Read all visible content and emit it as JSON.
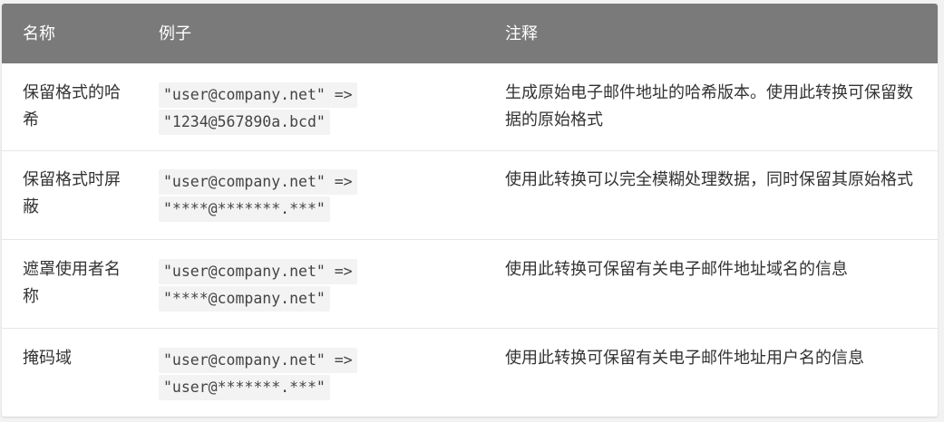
{
  "header": {
    "name": "名称",
    "example": "例子",
    "note": "注释"
  },
  "rows": [
    {
      "name": "保留格式的哈希",
      "example_line1": "\"user@company.net\" =>",
      "example_line2": "\"1234@567890a.bcd\"",
      "note": "生成原始电子邮件地址的哈希版本。使用此转换可保留数据的原始格式"
    },
    {
      "name": "保留格式时屏蔽",
      "example_line1": "\"user@company.net\" =>",
      "example_line2": "\"****@*******.***\"",
      "note": "使用此转换可以完全模糊处理数据，同时保留其原始格式"
    },
    {
      "name": "遮罩使用者名称",
      "example_line1": "\"user@company.net\" =>",
      "example_line2": "\"****@company.net\"",
      "note": "使用此转换可保留有关电子邮件地址域名的信息"
    },
    {
      "name": "掩码域",
      "example_line1": "\"user@company.net\" =>",
      "example_line2": "\"user@*******.***\"",
      "note": "使用此转换可保留有关电子邮件地址用户名的信息"
    }
  ]
}
